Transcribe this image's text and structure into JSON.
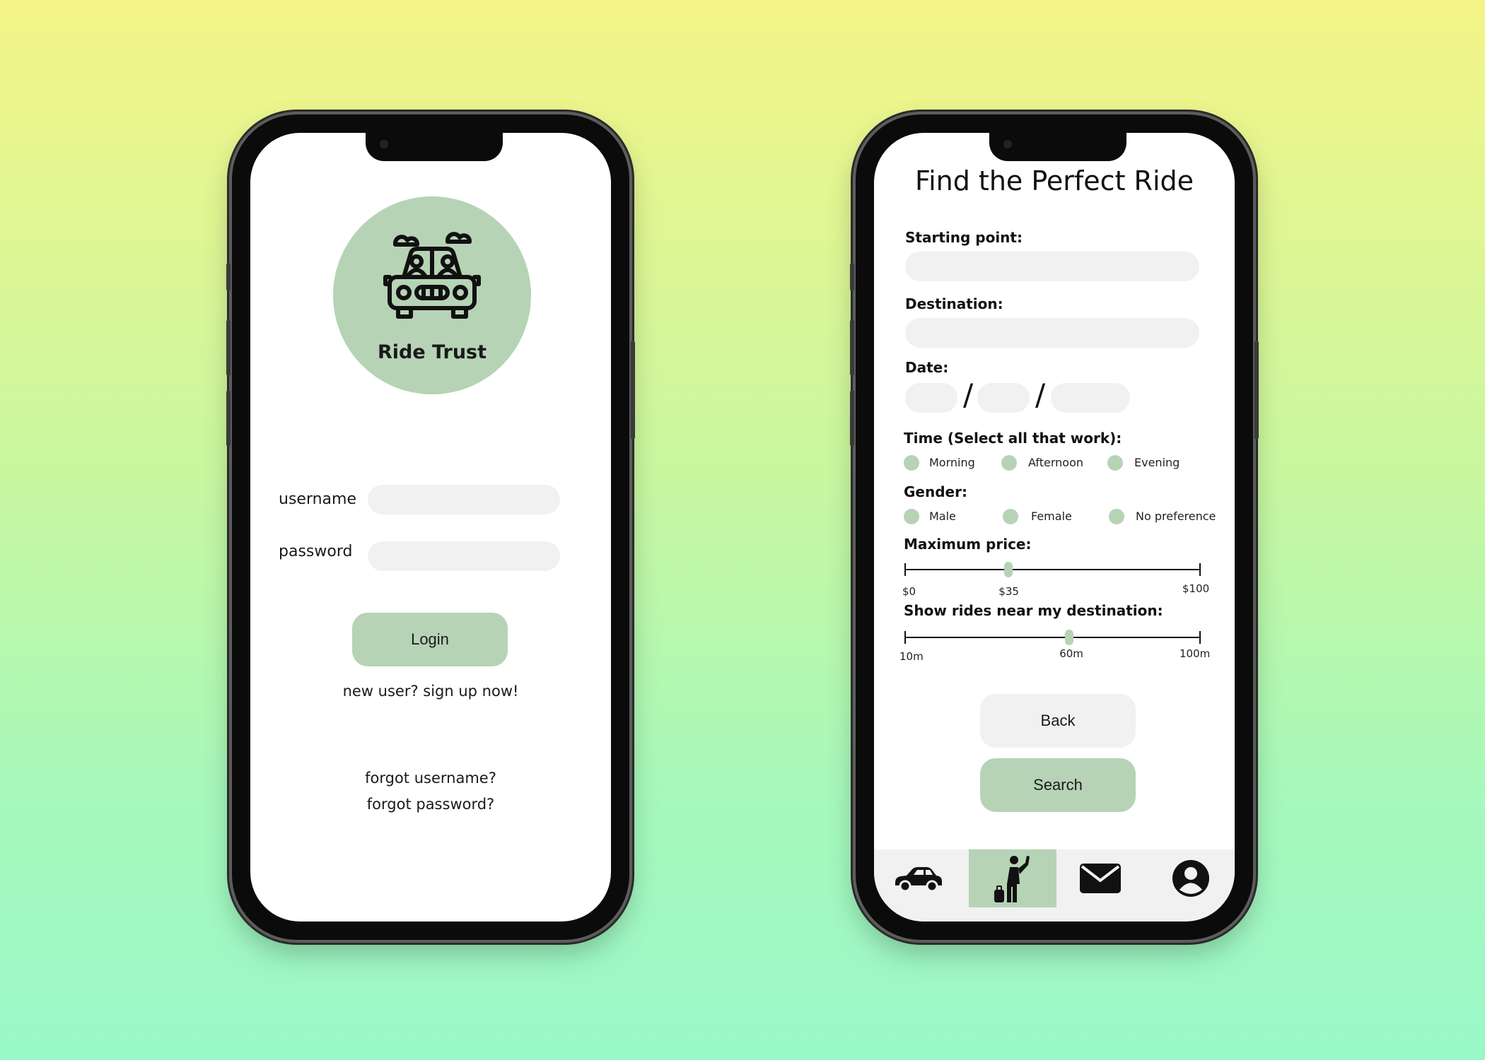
{
  "colors": {
    "accent_green": "#b6d3b6",
    "input_grey": "#f1f1f1",
    "text": "#111111"
  },
  "login": {
    "logo_icon": "carpool-car-icon",
    "app_name": "Ride Trust",
    "username_label": "username",
    "password_label": "password",
    "username_value": "",
    "password_value": "",
    "login_button": "Login",
    "signup_link": "new user? sign up now!",
    "forgot_username": "forgot username?",
    "forgot_password": "forgot password?"
  },
  "search": {
    "title": "Find the Perfect Ride",
    "starting_point_label": "Starting point:",
    "starting_point_value": "",
    "destination_label": "Destination:",
    "destination_value": "",
    "date_label": "Date:",
    "date_separator": "/",
    "time_label": "Time (Select all that work):",
    "time_options": [
      "Morning",
      "Afternoon",
      "Evening"
    ],
    "gender_label": "Gender:",
    "gender_options": [
      "Male",
      "Female",
      "No preference"
    ],
    "price_label": "Maximum price:",
    "price_slider": {
      "min_label": "$0",
      "value_label": "$35",
      "max_label": "$100",
      "min": 0,
      "max": 100,
      "value": 35
    },
    "radius_label": "Show rides near my destination:",
    "radius_slider": {
      "min_label": "10m",
      "value_label": "60m",
      "max_label": "100m",
      "min": 10,
      "max": 100,
      "value": 60
    },
    "back_button": "Back",
    "search_button": "Search"
  },
  "navbar": {
    "items": [
      {
        "icon": "car-icon",
        "active": false
      },
      {
        "icon": "hitchhiker-icon",
        "active": true
      },
      {
        "icon": "mail-icon",
        "active": false
      },
      {
        "icon": "profile-icon",
        "active": false
      }
    ]
  }
}
